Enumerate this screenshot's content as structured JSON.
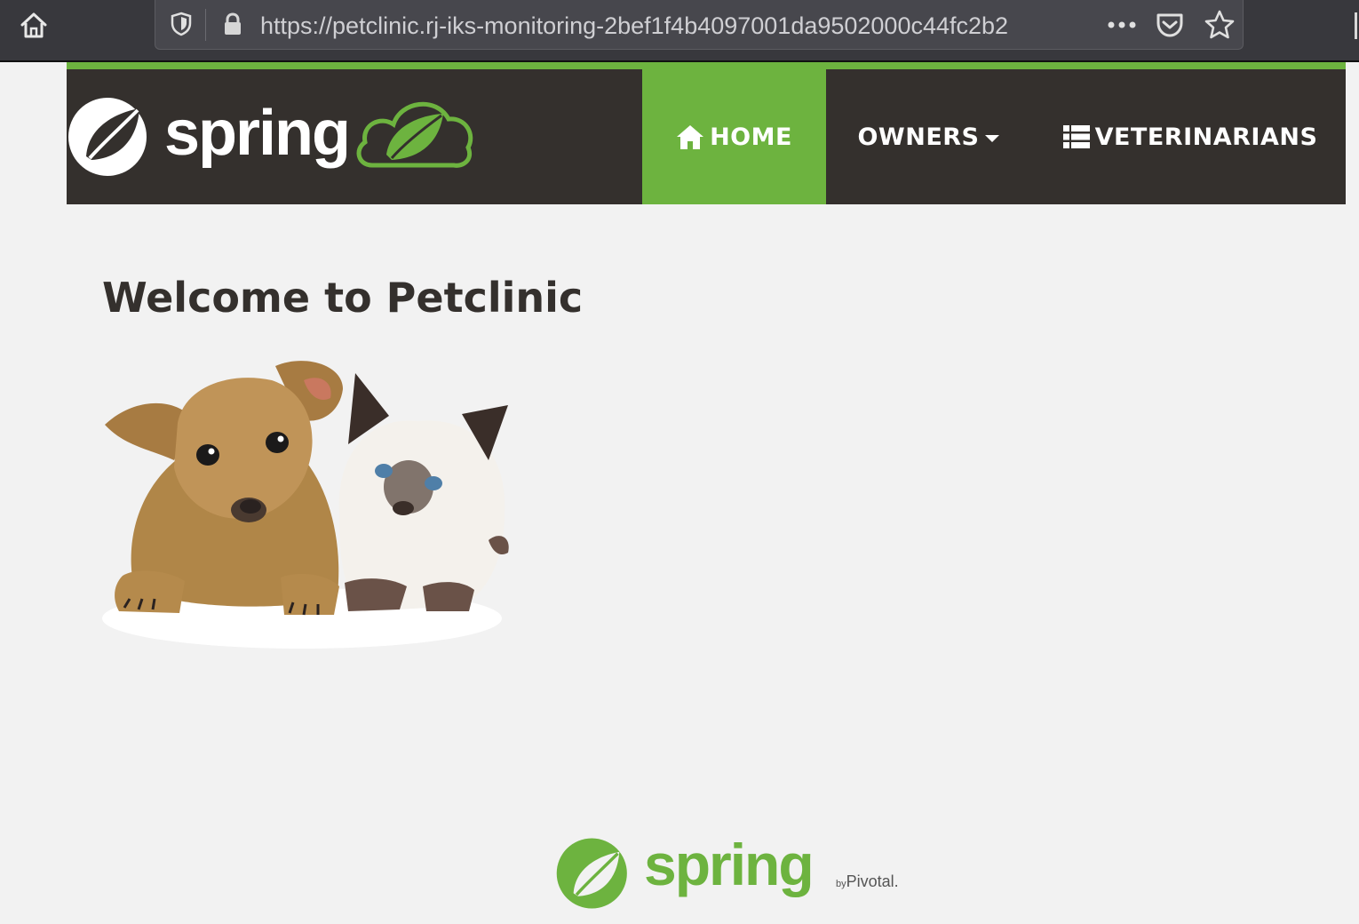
{
  "browser": {
    "url": "https://petclinic.rj-iks-monitoring-2bef1f4b4097001da9502000c44fc2b2",
    "icons": [
      "home-icon",
      "shield-icon",
      "lock-icon",
      "more-icon",
      "pocket-icon",
      "star-icon"
    ]
  },
  "navbar": {
    "brand_text": "spring",
    "items": [
      {
        "label": "HOME",
        "icon": "home-icon",
        "active": true
      },
      {
        "label": "OWNERS",
        "icon": "caret-down-icon",
        "active": false
      },
      {
        "label": "VETERINARIANS",
        "icon": "list-icon",
        "active": false
      }
    ]
  },
  "main": {
    "title": "Welcome to Petclinic",
    "image": "pets-image"
  },
  "footer": {
    "brand_text": "spring",
    "by_prefix": "by",
    "by_text": "Pivotal."
  },
  "colors": {
    "brand_green": "#6db33f",
    "navbar_bg": "#34302d",
    "page_bg": "#f2f2f2",
    "browser_bg": "#38383d"
  }
}
